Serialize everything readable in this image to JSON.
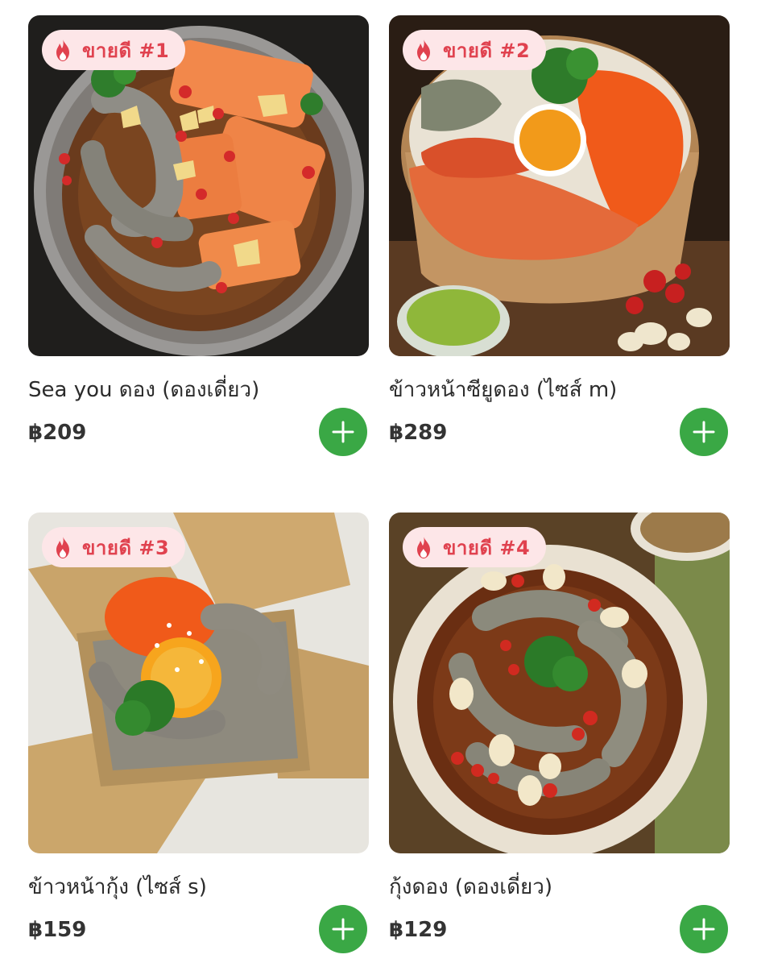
{
  "colors": {
    "badge_bg": "#fde6e8",
    "badge_text": "#e0424f",
    "add_button": "#3aa845",
    "text": "#2b2b2b"
  },
  "products": [
    {
      "badge": "ขายดี #1",
      "name": "Sea you ดอง (ดองเดี่ยว)",
      "price": "฿209",
      "badge_icon": "flame-icon",
      "add_icon": "plus-icon"
    },
    {
      "badge": "ขายดี #2",
      "name": "ข้าวหน้าซียูดอง (ไซส์ m)",
      "price": "฿289",
      "badge_icon": "flame-icon",
      "add_icon": "plus-icon"
    },
    {
      "badge": "ขายดี #3",
      "name": "ข้าวหน้ากุ้ง  (ไซส์ s)",
      "price": "฿159",
      "badge_icon": "flame-icon",
      "add_icon": "plus-icon"
    },
    {
      "badge": "ขายดี #4",
      "name": "กุ้งดอง (ดองเดี่ยว)",
      "price": "฿129",
      "badge_icon": "flame-icon",
      "add_icon": "plus-icon"
    }
  ]
}
